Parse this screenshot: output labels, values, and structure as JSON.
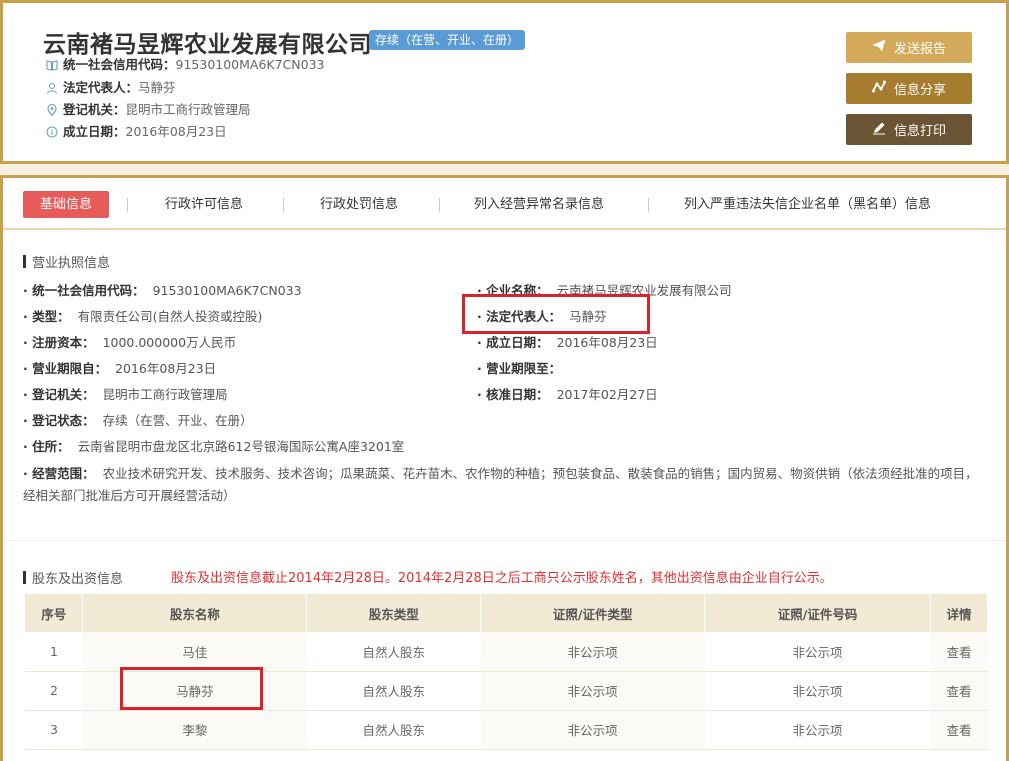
{
  "header": {
    "company_name": "云南褚马昱辉农业发展有限公司",
    "status": "存续（在营、开业、在册）",
    "meta": [
      {
        "icon": "book-icon",
        "label": "统一社会信用代码：",
        "value": "91530100MA6K7CN033"
      },
      {
        "icon": "person-icon",
        "label": "法定代表人：",
        "value": "马静芬"
      },
      {
        "icon": "location-pin-icon",
        "label": "登记机关：",
        "value": "昆明市工商行政管理局"
      },
      {
        "icon": "info-icon",
        "label": "成立日期：",
        "value": "2016年08月23日"
      }
    ],
    "buttons": {
      "report": "发送报告",
      "share": "信息分享",
      "print": "信息打印"
    }
  },
  "tabs": {
    "basic": "基础信息",
    "license": "行政许可信息",
    "penalty": "行政处罚信息",
    "abnormal": "列入经营异常名录信息",
    "blacklist": "列入严重违法失信企业名单（黑名单）信息"
  },
  "license_section": {
    "title": "营业执照信息",
    "fields": {
      "credit_code_label": "· 统一社会信用代码：",
      "credit_code": "91530100MA6K7CN033",
      "name_label": "· 企业名称：",
      "name": "云南褚马昱辉农业发展有限公司",
      "type_label": "· 类型：",
      "type": "有限责任公司(自然人投资或控股)",
      "legal_rep_label": "· 法定代表人：",
      "legal_rep": "马静芬",
      "capital_label": "· 注册资本：",
      "capital": "1000.000000万人民币",
      "established_label": "· 成立日期：",
      "established": "2016年08月23日",
      "term_from_label": "· 营业期限自：",
      "term_from": "2016年08月23日",
      "term_to_label": "· 营业期限至：",
      "term_to": "",
      "authority_label": "· 登记机关：",
      "authority": "昆明市工商行政管理局",
      "approved_label": "· 核准日期：",
      "approved": "2017年02月27日",
      "status_label": "· 登记状态：",
      "status": "存续（在营、开业、在册）",
      "address_label": "· 住所：",
      "address": "云南省昆明市盘龙区北京路612号银海国际公寓A座3201室",
      "scope_label": "· 经营范围：",
      "scope": "农业技术研究开发、技术服务、技术咨询；瓜果蔬菜、花卉苗木、农作物的种植；预包装食品、散装食品的销售；国内贸易、物资供销（依法须经批准的项目，经相关部门批准后方可开展经营活动）"
    }
  },
  "shareholder_section": {
    "title": "股东及出资信息",
    "notice": "股东及出资信息截止2014年2月28日。2014年2月28日之后工商只公示股东姓名，其他出资信息由企业自行公示。",
    "columns": [
      "序号",
      "股东名称",
      "股东类型",
      "证照/证件类型",
      "证照/证件号码",
      "详情"
    ],
    "rows": [
      {
        "no": "1",
        "name": "马佳",
        "type": "自然人股东",
        "id_type": "非公示项",
        "id_no": "非公示项",
        "detail": "查看"
      },
      {
        "no": "2",
        "name": "马静芬",
        "type": "自然人股东",
        "id_type": "非公示项",
        "id_no": "非公示项",
        "detail": "查看"
      },
      {
        "no": "3",
        "name": "李黎",
        "type": "自然人股东",
        "id_type": "非公示项",
        "id_no": "非公示项",
        "detail": "查看"
      }
    ]
  },
  "colors": {
    "gold_border": "#c6a04a",
    "badge_blue": "#5b9bd5",
    "tab_active": "#e85b5b",
    "highlight_red": "#d8232a",
    "notice_red": "#e03030"
  }
}
